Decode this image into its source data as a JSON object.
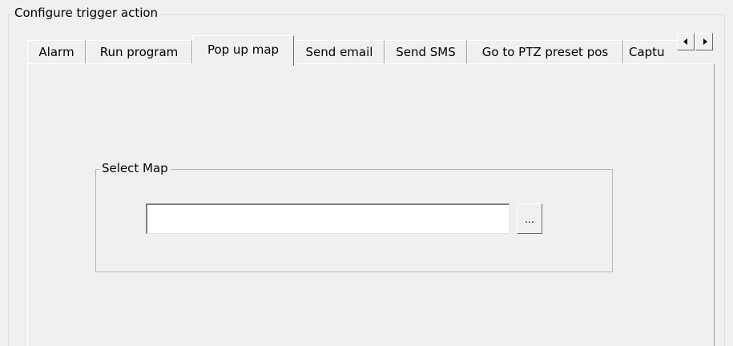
{
  "outer_group": {
    "title": "Configure trigger action"
  },
  "tabs": [
    {
      "label": "Alarm",
      "active": false
    },
    {
      "label": "Run program",
      "active": false
    },
    {
      "label": "Pop up map",
      "active": true
    },
    {
      "label": "Send email",
      "active": false
    },
    {
      "label": "Send SMS",
      "active": false
    },
    {
      "label": "Go to PTZ preset pos",
      "active": false
    },
    {
      "label": "Captu",
      "active": false
    }
  ],
  "tab_scroll": {
    "left_icon": "arrow-left-icon",
    "right_icon": "arrow-right-icon"
  },
  "select_map": {
    "title": "Select Map",
    "input_value": "",
    "browse_label": "..."
  }
}
